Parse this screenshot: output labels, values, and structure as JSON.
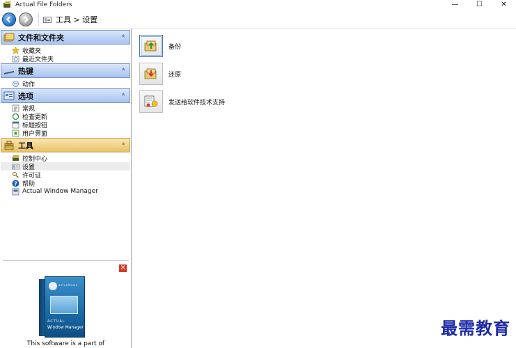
{
  "window": {
    "title": "Actual File Folders",
    "minimize_glyph": "—",
    "maximize_glyph": "☐",
    "close_glyph": "✕"
  },
  "navbar": {
    "breadcrumb": "工具 > 设置"
  },
  "sidebar": {
    "sections": [
      {
        "title": "文件和文件夹",
        "icon": "folders-icon",
        "items": [
          {
            "label": "收藏夹",
            "icon": "star-icon"
          },
          {
            "label": "最近文件夹",
            "icon": "recent-folder-icon"
          }
        ]
      },
      {
        "title": "热键",
        "icon": "hotkey-icon",
        "items": [
          {
            "label": "动作",
            "icon": "action-icon"
          }
        ]
      },
      {
        "title": "选项",
        "icon": "options-icon",
        "items": [
          {
            "label": "常规",
            "icon": "general-icon"
          },
          {
            "label": "检查更新",
            "icon": "update-icon"
          },
          {
            "label": "标题按钮",
            "icon": "title-buttons-icon"
          },
          {
            "label": "用户界面",
            "icon": "user-interface-icon"
          }
        ]
      },
      {
        "title": "工具",
        "icon": "tools-icon",
        "items": [
          {
            "label": "控制中心",
            "icon": "control-center-icon"
          },
          {
            "label": "设置",
            "icon": "settings-icon",
            "selected": true
          },
          {
            "label": "许可证",
            "icon": "license-icon"
          },
          {
            "label": "帮助",
            "icon": "help-icon"
          },
          {
            "label": "Actual Window Manager",
            "icon": "awm-icon"
          }
        ]
      }
    ],
    "collapse_glyph": "«"
  },
  "promo": {
    "box_brand": "actualtools",
    "box_line1": "ACTUAL",
    "box_line2": "Window Manager",
    "text": "This software is a part of"
  },
  "main": {
    "actions": [
      {
        "label": "备份",
        "icon": "backup-icon"
      },
      {
        "label": "还原",
        "icon": "restore-icon"
      },
      {
        "label": "发送给软件技术支持",
        "icon": "send-support-icon"
      }
    ]
  },
  "watermark": "最需教育",
  "colors": {
    "section_blue": "#a9c3ef",
    "section_gold": "#e9c26a",
    "selected_row": "#ececec"
  }
}
